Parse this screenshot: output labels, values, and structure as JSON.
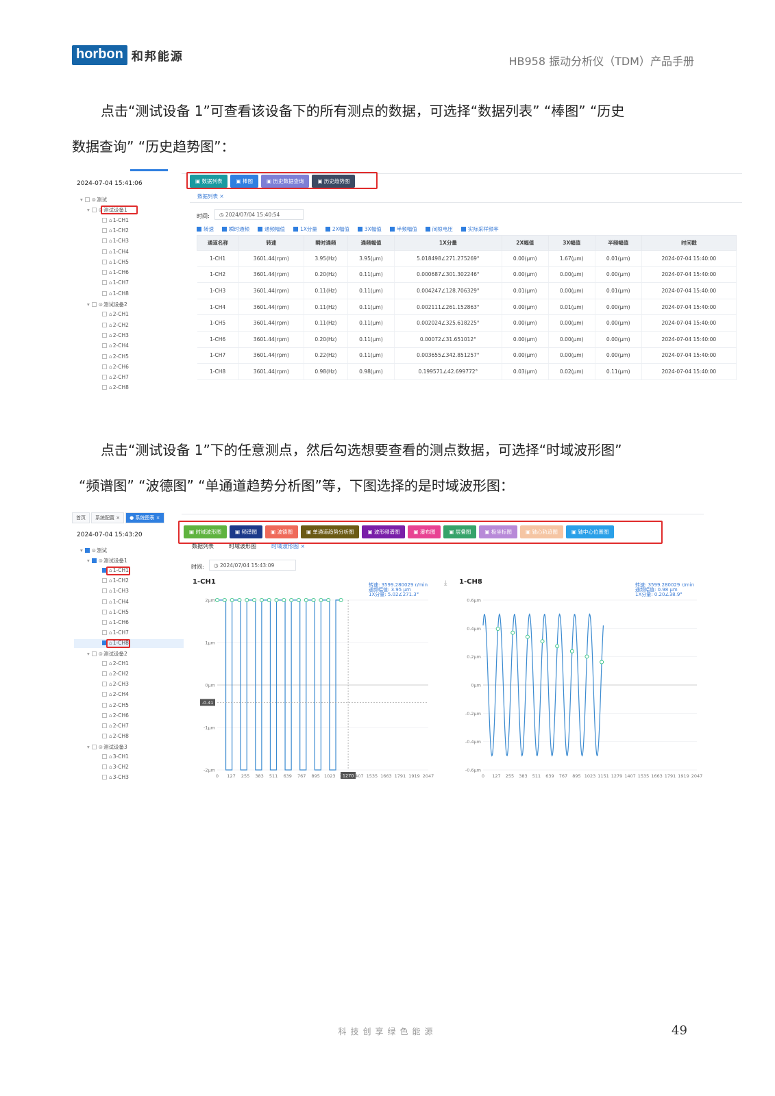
{
  "header": {
    "logo_text": "horbon",
    "logo_cn": "和邦能源",
    "doc_title": "HB958 振动分析仪（TDM）产品手册"
  },
  "para1": {
    "line1": "点击“测试设备 1”可查看该设备下的所有测点的数据，可选择“数据列表” “棒图” “历史",
    "line2": "数据查询” “历史趋势图”："
  },
  "para2": {
    "line1": "点击“测试设备 1”下的任意测点，然后勾选想要查看的测点数据，可选择“时域波形图”",
    "line2": "“频谱图” “波德图” “单通道趋势分析图”等，下图选择的是时域波形图："
  },
  "shot1": {
    "timestamp": "2024-07-04 15:41:06",
    "tree": [
      "测试",
      "测试设备1",
      "1-CH1",
      "1-CH2",
      "1-CH3",
      "1-CH4",
      "1-CH5",
      "1-CH6",
      "1-CH7",
      "1-CH8",
      "测试设备2",
      "2-CH1",
      "2-CH2",
      "2-CH3",
      "2-CH4",
      "2-CH5",
      "2-CH6",
      "2-CH7",
      "2-CH8"
    ],
    "buttons": [
      {
        "label": "数据列表",
        "color": "#1a9aa0"
      },
      {
        "label": "棒图",
        "color": "#2f7fe0"
      },
      {
        "label": "历史数据查询",
        "color": "#7d7fd6"
      },
      {
        "label": "历史趋势图",
        "color": "#3b4a63"
      }
    ],
    "tab": "数据列表 ×",
    "time_label": "时间:",
    "time_value": "2024/07/04 15:40:54",
    "checks": [
      "转速",
      "瞬时通频",
      "通频幅值",
      "1X分量",
      "2X幅值",
      "3X幅值",
      "半频幅值",
      "间隙电压",
      "实际采样频率"
    ],
    "columns": [
      "通道名称",
      "转速",
      "瞬时通频",
      "通频幅值",
      "1X分量",
      "2X幅值",
      "3X幅值",
      "半频幅值",
      "时间戳"
    ],
    "rows": [
      [
        "1-CH1",
        "3601.44(rpm)",
        "3.95(Hz)",
        "3.95(μm)",
        "5.018498∠271.275269°",
        "0.00(μm)",
        "1.67(μm)",
        "0.01(μm)",
        "2024-07-04 15:40:00"
      ],
      [
        "1-CH2",
        "3601.44(rpm)",
        "0.20(Hz)",
        "0.11(μm)",
        "0.000687∠301.302246°",
        "0.00(μm)",
        "0.00(μm)",
        "0.00(μm)",
        "2024-07-04 15:40:00"
      ],
      [
        "1-CH3",
        "3601.44(rpm)",
        "0.11(Hz)",
        "0.11(μm)",
        "0.004247∠128.706329°",
        "0.01(μm)",
        "0.00(μm)",
        "0.01(μm)",
        "2024-07-04 15:40:00"
      ],
      [
        "1-CH4",
        "3601.44(rpm)",
        "0.11(Hz)",
        "0.11(μm)",
        "0.002111∠261.152863°",
        "0.00(μm)",
        "0.01(μm)",
        "0.00(μm)",
        "2024-07-04 15:40:00"
      ],
      [
        "1-CH5",
        "3601.44(rpm)",
        "0.11(Hz)",
        "0.11(μm)",
        "0.002024∠325.618225°",
        "0.00(μm)",
        "0.00(μm)",
        "0.00(μm)",
        "2024-07-04 15:40:00"
      ],
      [
        "1-CH6",
        "3601.44(rpm)",
        "0.20(Hz)",
        "0.11(μm)",
        "0.00072∠31.651012°",
        "0.00(μm)",
        "0.00(μm)",
        "0.00(μm)",
        "2024-07-04 15:40:00"
      ],
      [
        "1-CH7",
        "3601.44(rpm)",
        "0.22(Hz)",
        "0.11(μm)",
        "0.003655∠342.851257°",
        "0.00(μm)",
        "0.00(μm)",
        "0.00(μm)",
        "2024-07-04 15:40:00"
      ],
      [
        "1-CH8",
        "3601.44(rpm)",
        "0.98(Hz)",
        "0.98(μm)",
        "0.199571∠42.699772°",
        "0.03(μm)",
        "0.02(μm)",
        "0.11(μm)",
        "2024-07-04 15:40:00"
      ]
    ]
  },
  "shot2": {
    "top_tabs": [
      "首页",
      "系统配置 ×",
      "● 系统图表 ×"
    ],
    "timestamp": "2024-07-04 15:43:20",
    "tree": [
      "测试",
      "测试设备1",
      "1-CH1",
      "1-CH2",
      "1-CH3",
      "1-CH4",
      "1-CH5",
      "1-CH6",
      "1-CH7",
      "1-CH8",
      "测试设备2",
      "2-CH1",
      "2-CH2",
      "2-CH3",
      "2-CH4",
      "2-CH5",
      "2-CH6",
      "2-CH7",
      "2-CH8",
      "测试设备3",
      "3-CH1",
      "3-CH2",
      "3-CH3"
    ],
    "buttons": [
      {
        "label": "时域波形图",
        "color": "#5fb33f"
      },
      {
        "label": "频谱图",
        "color": "#1d3a8a"
      },
      {
        "label": "波德图",
        "color": "#ef6a5a"
      },
      {
        "label": "单通道趋势分析图",
        "color": "#6b5a14"
      },
      {
        "label": "波形频谱图",
        "color": "#7a1fa8"
      },
      {
        "label": "瀑布图",
        "color": "#e84393"
      },
      {
        "label": "层叠图",
        "color": "#36a36a"
      },
      {
        "label": "极坐标图",
        "color": "#b88ad8"
      },
      {
        "label": "轴心轨迹图",
        "color": "#f5c5a3"
      },
      {
        "label": "轴中心位置图",
        "color": "#2aa0e8"
      }
    ],
    "subtabs": [
      "数据列表",
      "时域波形图",
      "时域波形图 ×"
    ],
    "time_label": "时间:",
    "time_value": "2024/07/04 15:43:09",
    "chart_data": [
      {
        "type": "line",
        "title": "1-CH1",
        "info": [
          "转速: 3599.280029 r/min",
          "通频幅值: 3.95 μm",
          "1X分量: 5.02∠271.3°"
        ],
        "ylim": [
          -2,
          2
        ],
        "ytick_labels": [
          "2μm",
          "1μm",
          "0μm",
          "-1μm",
          "-2μm"
        ],
        "xtick_labels": [
          "0",
          "127",
          "255",
          "383",
          "511",
          "639",
          "767",
          "895",
          "1023",
          "115",
          "1407",
          "1535",
          "1663",
          "1791",
          "1919",
          "2047"
        ],
        "cursor_x": "1270",
        "cursor_y": "-0.41",
        "series": [
          {
            "waveform": "square",
            "high": 2,
            "low": -2,
            "cycles": 8,
            "x_end": 1150
          }
        ]
      },
      {
        "type": "line",
        "title": "1-CH8",
        "info": [
          "转速: 3599.280029 r/min",
          "通频幅值: 0.98 μm",
          "1X分量: 0.20∠38.9°"
        ],
        "ylim": [
          -0.6,
          0.6
        ],
        "ytick_labels": [
          "0.6μm",
          "0.4μm",
          "0.2μm",
          "0μm",
          "-0.2μm",
          "-0.4μm",
          "-0.6μm"
        ],
        "xtick_labels": [
          "0",
          "127",
          "255",
          "383",
          "511",
          "639",
          "767",
          "895",
          "1023",
          "1151",
          "1279",
          "1407",
          "1535",
          "1663",
          "1791",
          "1919",
          "2047"
        ],
        "series": [
          {
            "waveform": "sine",
            "amplitude": 0.5,
            "cycles": 8,
            "x_end": 1151
          }
        ]
      }
    ]
  },
  "footer": {
    "slogan": "科技创享绿色能源",
    "page": "49"
  }
}
